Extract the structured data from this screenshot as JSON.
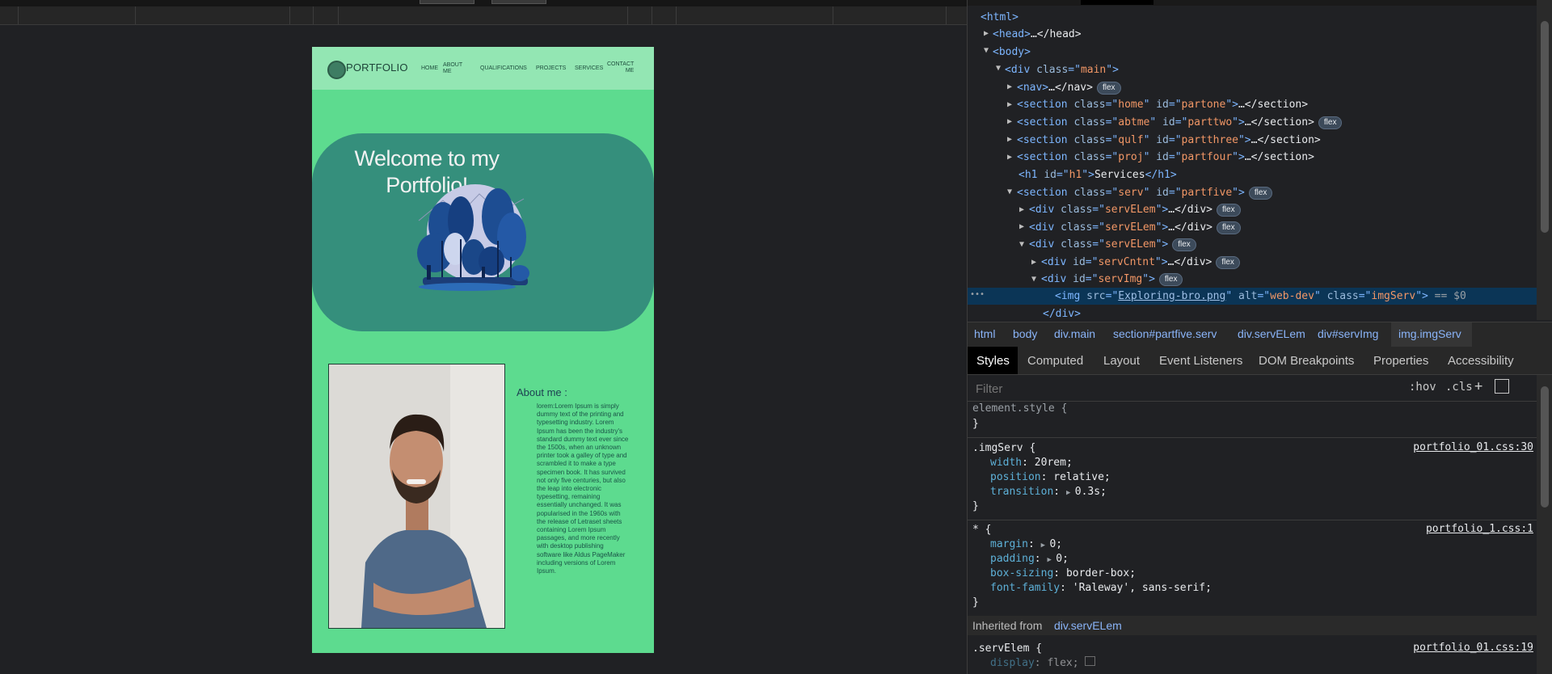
{
  "site": {
    "logo_text": "PORTFOLIO",
    "nav": [
      "HOME",
      "ABOUT\nME",
      "QUALIFICATIONS",
      "PROJECTS",
      "SERVICES",
      "CONTACT\nME"
    ],
    "hero_title": "Welcome to my Portfolio!",
    "about_title": "About me :",
    "about_body": "lorem:Lorem Ipsum is simply dummy text of the printing and typesetting industry. Lorem Ipsum has been the industry's standard dummy text ever since the 1500s, when an unknown printer took a galley of type and scrambled it to make a type specimen book. It has survived not only five centuries, but also the leap into electronic typesetting, remaining essentially unchanged. It was popularised in the 1960s with the release of Letraset sheets containing Lorem Ipsum passages, and more recently with desktop publishing software like Aldus PageMaker including versions of Lorem Ipsum."
  },
  "dom": {
    "badge": "flex",
    "lines": [
      {
        "tag": "<html>"
      },
      {
        "open": "<head>",
        "rest": "…</head>"
      },
      {
        "tag": "<body>"
      },
      {
        "tagname": "div",
        "attr": "class",
        "val": "main"
      },
      {
        "open": "<nav>",
        "rest": "…</nav>"
      },
      {
        "tagname": "section",
        "attr": "class",
        "val": "home",
        "attr2": "id",
        "val2": "partone",
        "rest": "…</section>"
      },
      {
        "tagname": "section",
        "attr": "class",
        "val": "abtme",
        "attr2": "id",
        "val2": "parttwo",
        "rest": "…</section>"
      },
      {
        "tagname": "section",
        "attr": "class",
        "val": "qulf",
        "attr2": "id",
        "val2": "partthree",
        "rest": "…</section>"
      },
      {
        "tagname": "section",
        "attr": "class",
        "val": "proj",
        "attr2": "id",
        "val2": "partfour",
        "rest": "…</section>"
      },
      {
        "tagname": "h1",
        "attr": "id",
        "val": "h1",
        "text": "Services",
        "close": "</h1>"
      },
      {
        "tagname": "section",
        "attr": "class",
        "val": "serv",
        "attr2": "id",
        "val2": "partfive"
      },
      {
        "tagname": "div",
        "attr": "class",
        "val": "servELem",
        "rest": "…</div>"
      },
      {
        "tagname": "div",
        "attr": "class",
        "val": "servELem",
        "rest": "…</div>"
      },
      {
        "tagname": "div",
        "attr": "class",
        "val": "servELem"
      },
      {
        "tagname": "div",
        "attr": "id",
        "val": "servCntnt",
        "rest": "…</div>"
      },
      {
        "tagname": "div",
        "attr": "id",
        "val": "servImg"
      },
      {
        "tagname": "img",
        "attr": "src",
        "val": "Exploring-bro.png",
        "attr2": "alt",
        "val2": "web-dev",
        "attr3": "class",
        "val3": "imgServ",
        "tail": "== $0"
      },
      {
        "close": "</div>"
      }
    ]
  },
  "breadcrumb": [
    "html",
    "body",
    "div.main",
    "section#partfive.serv",
    "div.servELem",
    "div#servImg",
    "img.imgServ"
  ],
  "subtabs": [
    "Styles",
    "Computed",
    "Layout",
    "Event Listeners",
    "DOM Breakpoints",
    "Properties",
    "Accessibility"
  ],
  "filter": {
    "placeholder": "Filter",
    "hov": ":hov",
    "cls": ".cls",
    "plus": "+"
  },
  "styles": {
    "element_style": "element.style {",
    "close": "}",
    "rule1": {
      "selector": ".imgServ {",
      "source": "portfolio_01.css:30",
      "props": [
        [
          "width",
          "20rem"
        ],
        [
          "position",
          "relative"
        ],
        [
          "transition",
          "0.3s"
        ]
      ]
    },
    "rule2": {
      "selector": "* {",
      "source": "portfolio_1.css:1",
      "props": [
        [
          "margin",
          "0"
        ],
        [
          "padding",
          "0"
        ],
        [
          "box-sizing",
          "border-box"
        ],
        [
          "font-family",
          "'Raleway', sans-serif"
        ]
      ]
    },
    "inherited_label": "Inherited from",
    "inherited_from": "div.servELem",
    "rule3": {
      "selector": ".servElem {",
      "source": "portfolio_01.css:19",
      "props": [
        [
          "display",
          "flex"
        ]
      ]
    }
  },
  "colors": {
    "site_bg": "#5ddb8f",
    "nav_bg": "#93e6b3",
    "hero_bg": "#358f7c",
    "devtools_bg": "#202124",
    "selected_row": "#0b3556"
  }
}
